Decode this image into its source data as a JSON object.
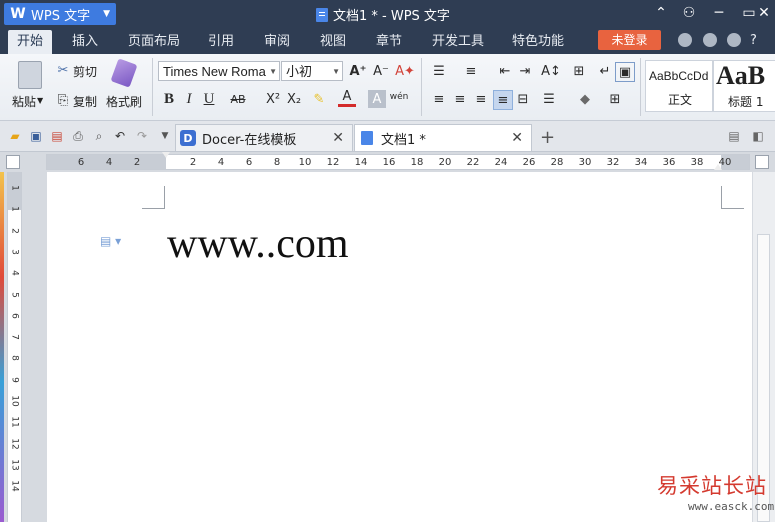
{
  "app": {
    "name": "WPS 文字",
    "window_title": "文档1 * - WPS 文字"
  },
  "window_controls": {
    "collapse": "⌃",
    "skin": "⚇",
    "minimize": "─",
    "maximize": "▭",
    "close": "✕"
  },
  "menu": {
    "items": [
      "开始",
      "插入",
      "页面布局",
      "引用",
      "审阅",
      "视图",
      "章节",
      "开发工具",
      "特色功能"
    ],
    "login": "未登录",
    "help": "?"
  },
  "ribbon": {
    "paste": "粘贴",
    "cut": "剪切",
    "copy": "复制",
    "format_painter": "格式刷",
    "font_name": "Times New Roma",
    "font_size": "小初",
    "bold": "B",
    "italic": "I",
    "underline": "U",
    "strikethrough": "AB",
    "superscript": "X²",
    "subscript": "X₂",
    "style_normal_preview": "AaBbCcDd",
    "style_normal": "正文",
    "style_heading_preview": "AaB",
    "style_heading": "标题 1"
  },
  "tabs": [
    {
      "label": "Docer-在线模板",
      "active": false
    },
    {
      "label": "文档1 *",
      "active": true
    }
  ],
  "ruler": {
    "h_ticks": [
      "6",
      "4",
      "2",
      "",
      "2",
      "4",
      "6",
      "8",
      "10",
      "12",
      "14",
      "16",
      "18",
      "20",
      "22",
      "24",
      "26",
      "28",
      "30",
      "32",
      "34",
      "36",
      "38",
      "40"
    ],
    "v_ticks": [
      "1",
      "1",
      "2",
      "3",
      "4",
      "5",
      "6",
      "7",
      "8",
      "9",
      "10",
      "11",
      "12",
      "13",
      "14"
    ]
  },
  "document": {
    "text": "www..com"
  },
  "watermark": {
    "site_name": "易采站长站",
    "url": "www.easck.com"
  },
  "colors": {
    "titlebar": "#2f3d53",
    "app_button": "#3e7be0",
    "login_button": "#e8633f",
    "watermark": "#d43a2f"
  }
}
